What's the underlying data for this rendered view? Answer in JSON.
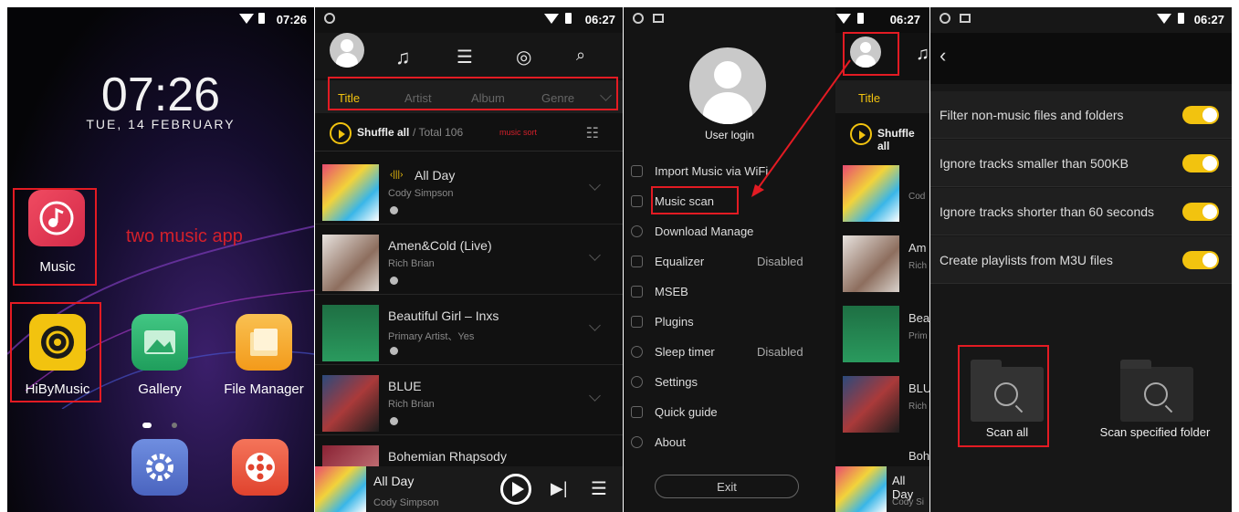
{
  "home": {
    "time": "07:26",
    "clock": "07:26",
    "date": "TUE, 14 FEBRUARY",
    "annotation": "two music app",
    "apps": [
      {
        "label": "Music",
        "icon": "music-note-icon"
      },
      {
        "label": "HiByMusic",
        "icon": "hiby-icon"
      },
      {
        "label": "Gallery",
        "icon": "gallery-icon"
      },
      {
        "label": "File Manager",
        "icon": "folder-icon"
      }
    ]
  },
  "library": {
    "time": "06:27",
    "tabs": [
      "Title",
      "Artist",
      "Album",
      "Genre"
    ],
    "shuffle_label": "Shuffle all",
    "total_label": "/ Total 106",
    "sort_note": "music sort",
    "tracks": [
      {
        "title": "All Day",
        "artist": "Cody Simpson"
      },
      {
        "title": "Amen&Cold (Live)",
        "artist": "Rich Brian"
      },
      {
        "title": "Beautiful Girl – Inxs",
        "artist": "Primary Artist、Yes"
      },
      {
        "title": "BLUE",
        "artist": "Rich Brian"
      },
      {
        "title": "Bohemian Rhapsody",
        "artist": ""
      }
    ],
    "now_playing": {
      "title": "All Day",
      "artist": "Cody Simpson"
    }
  },
  "menu": {
    "time": "06:27",
    "user_login": "User login",
    "items": [
      {
        "label": "Import Music via WiFi",
        "value": ""
      },
      {
        "label": "Music scan",
        "value": ""
      },
      {
        "label": "Download Manage",
        "value": ""
      },
      {
        "label": "Equalizer",
        "value": "Disabled"
      },
      {
        "label": "MSEB",
        "value": ""
      },
      {
        "label": "Plugins",
        "value": ""
      },
      {
        "label": "Sleep timer",
        "value": "Disabled"
      },
      {
        "label": "Settings",
        "value": ""
      },
      {
        "label": "Quick guide",
        "value": ""
      },
      {
        "label": "About",
        "value": ""
      }
    ],
    "exit_label": "Exit",
    "behind_tab": "Title",
    "behind_shuffle": "Shuffle all",
    "behind_rows": [
      "Cod",
      "Am",
      "Rich",
      "Bea",
      "Prim",
      "BLU",
      "Rich",
      "Boh"
    ],
    "behind_now": {
      "title": "All Day",
      "artist": "Cody Si"
    }
  },
  "scan": {
    "time": "06:27",
    "settings": [
      {
        "label": "Filter non-music files and folders",
        "on": true
      },
      {
        "label": "Ignore tracks smaller than 500KB",
        "on": true
      },
      {
        "label": "Ignore tracks shorter than 60 seconds",
        "on": true
      },
      {
        "label": "Create playlists from M3U files",
        "on": true
      }
    ],
    "scan_all": "Scan all",
    "scan_folder": "Scan specified folder"
  },
  "colors": {
    "accent": "#f2c30f",
    "annotation_red": "#e31b23"
  }
}
